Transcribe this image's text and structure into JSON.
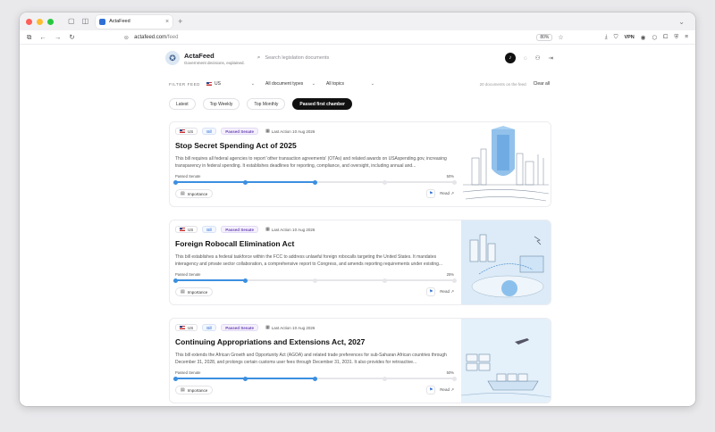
{
  "browser": {
    "tab_title": "ActaFeed",
    "url_host": "actafeed.com",
    "url_path": "/feed",
    "zoom": "80%",
    "vpn": "VPN"
  },
  "app": {
    "brand_name": "ActaFeed",
    "brand_tagline": "Government decisions, explained.",
    "search_placeholder": "Search legislation documents"
  },
  "filters": {
    "label": "FILTER FEED",
    "country": "US",
    "doc_type": "All document types",
    "topic": "All topics",
    "doc_count": "20 documents on the feed",
    "clear": "Clear all"
  },
  "feed_tabs": [
    {
      "label": "Latest",
      "active": false
    },
    {
      "label": "Top Weekly",
      "active": false
    },
    {
      "label": "Top Monthly",
      "active": false
    },
    {
      "label": "Passed first chamber",
      "active": true
    }
  ],
  "cards": [
    {
      "country": "US",
      "type": "Bill",
      "status": "Passed Senate",
      "last_action": "Last Action 10 Aug 2026",
      "title": "Stop Secret Spending Act of 2025",
      "summary": "This bill requires all federal agencies to report 'other transaction agreements' (OTAs) and related awards on USAspending.gov, increasing transparency in federal spending. It establishes deadlines for reporting, compliance, and oversight, including annual and...",
      "progress_label": "Passed Senate",
      "progress_pct_label": "50%",
      "progress": 0.5,
      "importance": "Importance",
      "read": "Read"
    },
    {
      "country": "US",
      "type": "Bill",
      "status": "Passed Senate",
      "last_action": "Last Action 10 Aug 2026",
      "title": "Foreign Robocall Elimination Act",
      "summary": "This bill establishes a federal taskforce within the FCC to address unlawful foreign robocalls targeting the United States. It mandates interagency and private sector collaboration, a comprehensive report to Congress, and amends reporting requirements under existing...",
      "progress_label": "Passed Senate",
      "progress_pct_label": "25%",
      "progress": 0.25,
      "importance": "Importance",
      "read": "Read"
    },
    {
      "country": "US",
      "type": "Bill",
      "status": "Passed Senate",
      "last_action": "Last Action 10 Aug 2026",
      "title": "Continuing Appropriations and Extensions Act, 2027",
      "summary": "This bill extends the African Growth and Opportunity Act (AGOA) and related trade preferences for sub-Saharan African countries through December 31, 2028, and prolongs certain customs user fees through December 31, 2031. It also provides for retroactive...",
      "progress_label": "Passed Senate",
      "progress_pct_label": "50%",
      "progress": 0.5,
      "importance": "Importance",
      "read": "Read"
    }
  ]
}
